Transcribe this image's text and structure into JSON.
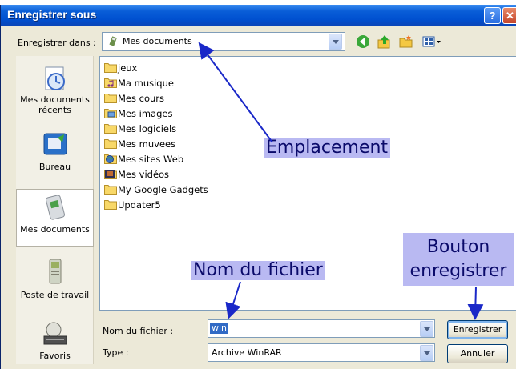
{
  "window": {
    "title": "Enregistrer sous",
    "help_label": "?",
    "close_label": "✕"
  },
  "save_in": {
    "label": "Enregistrer dans :",
    "value": "Mes documents",
    "icon": "my-documents-icon"
  },
  "toolbar": {
    "icons": [
      "back-icon",
      "up-folder-icon",
      "new-folder-icon",
      "view-menu-icon"
    ]
  },
  "places": [
    {
      "label": "Mes documents récents",
      "icon": "recent-documents-icon"
    },
    {
      "label": "Bureau",
      "icon": "desktop-icon"
    },
    {
      "label": "Mes documents",
      "icon": "my-documents-icon"
    },
    {
      "label": "Poste de travail",
      "icon": "my-computer-icon"
    },
    {
      "label": "Favoris",
      "icon": "network-places-icon"
    }
  ],
  "files": [
    {
      "name": "jeux",
      "icon": "folder-icon"
    },
    {
      "name": "Ma musique",
      "icon": "music-folder-icon"
    },
    {
      "name": "Mes cours",
      "icon": "folder-icon"
    },
    {
      "name": "Mes images",
      "icon": "pictures-folder-icon"
    },
    {
      "name": "Mes logiciels",
      "icon": "folder-icon"
    },
    {
      "name": "Mes muvees",
      "icon": "folder-icon"
    },
    {
      "name": "Mes sites Web",
      "icon": "web-folder-icon"
    },
    {
      "name": "Mes vidéos",
      "icon": "video-folder-icon"
    },
    {
      "name": "My Google Gadgets",
      "icon": "folder-icon"
    },
    {
      "name": "Updater5",
      "icon": "folder-icon"
    }
  ],
  "filename": {
    "label": "Nom du fichier :",
    "value": "win"
  },
  "filetype": {
    "label": "Type :",
    "value": "Archive WinRAR"
  },
  "buttons": {
    "save": "Enregistrer",
    "cancel": "Annuler"
  },
  "annotations": {
    "location": "Emplacement",
    "filename": "Nom du fichier",
    "save_button_line1": "Bouton",
    "save_button_line2": "enregistrer"
  },
  "colors": {
    "titlebar": "#0a5ed8",
    "annotation_bg": "#b9b9f2",
    "arrow": "#1a28c8",
    "selection": "#316ac5"
  }
}
